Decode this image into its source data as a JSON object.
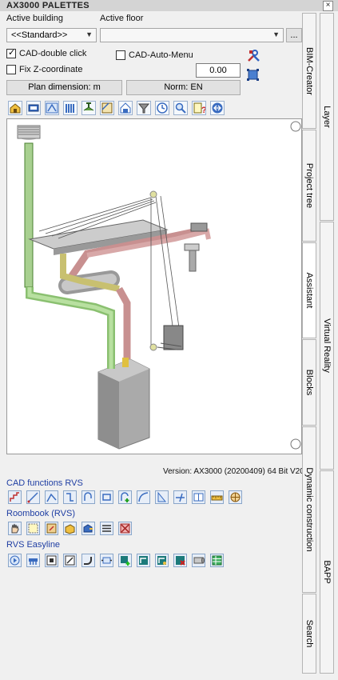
{
  "window": {
    "title": "AX3000 PALETTES",
    "close_glyph": "×"
  },
  "fields": {
    "active_building_label": "Active building",
    "active_floor_label": "Active floor",
    "building_value": "<<Standard>>",
    "floor_value": "",
    "browse_label": "..."
  },
  "options": {
    "cad_double_click": {
      "label": "CAD-double click",
      "checked": true
    },
    "cad_auto_menu": {
      "label": "CAD-Auto-Menu",
      "checked": false
    },
    "fix_z": {
      "label": "Fix Z-coordinate",
      "checked": false
    },
    "z_value": "0.00"
  },
  "buttons": {
    "plan_dimension": "Plan dimension: m",
    "norm": "Norm: EN"
  },
  "version": "Version: AX3000 (20200409) 64 Bit V202",
  "sections": {
    "cad_functions": "CAD functions RVS",
    "roombook": "Roombook (RVS)",
    "easyline": "RVS Easyline"
  },
  "tabs_inner": [
    "BIM-Creator",
    "Project tree",
    "Assistant",
    "Blocks",
    "Dynamic construction",
    "Search"
  ],
  "tabs_outer": [
    "Layer",
    "Virtual Reality",
    "BAPP"
  ]
}
